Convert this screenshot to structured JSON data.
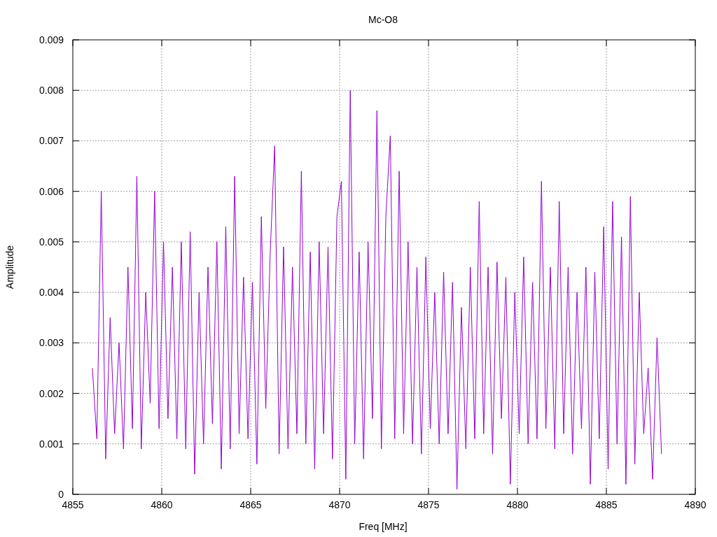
{
  "chart_data": {
    "type": "line",
    "title": "Mc-O8",
    "xlabel": "Freq [MHz]",
    "ylabel": "Amplitude",
    "xlim": [
      4855,
      4890
    ],
    "ylim": [
      0,
      0.009
    ],
    "grid": true,
    "xticks": [
      4855,
      4860,
      4865,
      4870,
      4875,
      4880,
      4885,
      4890
    ],
    "yticks": [
      {
        "value": 0,
        "label": "0"
      },
      {
        "value": 0.001,
        "label": "0.001"
      },
      {
        "value": 0.002,
        "label": "0.002"
      },
      {
        "value": 0.003,
        "label": "0.003"
      },
      {
        "value": 0.004,
        "label": "0.004"
      },
      {
        "value": 0.005,
        "label": "0.005"
      },
      {
        "value": 0.006,
        "label": "0.006"
      },
      {
        "value": 0.007,
        "label": "0.007"
      },
      {
        "value": 0.008,
        "label": "0.008"
      },
      {
        "value": 0.009,
        "label": "0.009"
      }
    ],
    "x": [
      4856.1,
      4856.35,
      4856.6,
      4856.85,
      4857.1,
      4857.35,
      4857.6,
      4857.85,
      4858.1,
      4858.35,
      4858.6,
      4858.85,
      4859.1,
      4859.35,
      4859.6,
      4859.85,
      4860.1,
      4860.35,
      4860.6,
      4860.85,
      4861.1,
      4861.35,
      4861.6,
      4861.85,
      4862.1,
      4862.35,
      4862.6,
      4862.85,
      4863.1,
      4863.35,
      4863.6,
      4863.85,
      4864.1,
      4864.35,
      4864.6,
      4864.85,
      4865.1,
      4865.35,
      4865.6,
      4865.85,
      4866.1,
      4866.35,
      4866.6,
      4866.85,
      4867.1,
      4867.35,
      4867.6,
      4867.85,
      4868.1,
      4868.35,
      4868.6,
      4868.85,
      4869.1,
      4869.35,
      4869.6,
      4869.85,
      4870.1,
      4870.35,
      4870.6,
      4870.85,
      4871.1,
      4871.35,
      4871.6,
      4871.85,
      4872.1,
      4872.35,
      4872.6,
      4872.85,
      4873.1,
      4873.35,
      4873.6,
      4873.85,
      4874.1,
      4874.35,
      4874.6,
      4874.85,
      4875.1,
      4875.35,
      4875.6,
      4875.85,
      4876.1,
      4876.35,
      4876.6,
      4876.85,
      4877.1,
      4877.35,
      4877.6,
      4877.85,
      4878.1,
      4878.35,
      4878.6,
      4878.85,
      4879.1,
      4879.35,
      4879.6,
      4879.85,
      4880.1,
      4880.35,
      4880.6,
      4880.85,
      4881.1,
      4881.35,
      4881.6,
      4881.85,
      4882.1,
      4882.35,
      4882.6,
      4882.85,
      4883.1,
      4883.35,
      4883.6,
      4883.85,
      4884.1,
      4884.35,
      4884.6,
      4884.85,
      4885.1,
      4885.35,
      4885.6,
      4885.85,
      4886.1,
      4886.35,
      4886.6,
      4886.85,
      4887.1,
      4887.35,
      4887.6,
      4887.85,
      4888.1
    ],
    "series": [
      {
        "color": "#9400d3",
        "values": [
          0.0025,
          0.0011,
          0.006,
          0.0007,
          0.0035,
          0.0012,
          0.003,
          0.0009,
          0.0045,
          0.0013,
          0.0063,
          0.0009,
          0.004,
          0.0018,
          0.006,
          0.0013,
          0.005,
          0.0015,
          0.0045,
          0.0011,
          0.005,
          0.0009,
          0.0052,
          0.0004,
          0.004,
          0.001,
          0.0045,
          0.0014,
          0.005,
          0.0005,
          0.0053,
          0.0009,
          0.0063,
          0.0012,
          0.0043,
          0.0011,
          0.0042,
          0.0006,
          0.0055,
          0.0017,
          0.0048,
          0.0069,
          0.0008,
          0.0049,
          0.0009,
          0.0045,
          0.0012,
          0.0064,
          0.001,
          0.0048,
          0.0005,
          0.005,
          0.0012,
          0.0049,
          0.0007,
          0.0055,
          0.0062,
          0.0003,
          0.008,
          0.001,
          0.0048,
          0.0007,
          0.005,
          0.0015,
          0.0076,
          0.0009,
          0.0055,
          0.0071,
          0.0011,
          0.0064,
          0.0012,
          0.005,
          0.001,
          0.0045,
          0.0008,
          0.0047,
          0.0013,
          0.004,
          0.001,
          0.0044,
          0.0012,
          0.0042,
          0.0001,
          0.0037,
          0.0009,
          0.0045,
          0.0011,
          0.0058,
          0.0012,
          0.0045,
          0.0008,
          0.0046,
          0.0015,
          0.0043,
          0.0002,
          0.004,
          0.0012,
          0.0047,
          0.001,
          0.0042,
          0.0011,
          0.0062,
          0.0013,
          0.0045,
          0.0009,
          0.0058,
          0.0012,
          0.0045,
          0.0008,
          0.004,
          0.0013,
          0.0045,
          0.0002,
          0.0044,
          0.0011,
          0.0053,
          0.0005,
          0.0058,
          0.001,
          0.0051,
          0.0002,
          0.0059,
          0.0006,
          0.004,
          0.0012,
          0.0025,
          0.0003,
          0.0031,
          0.0008
        ]
      }
    ]
  }
}
